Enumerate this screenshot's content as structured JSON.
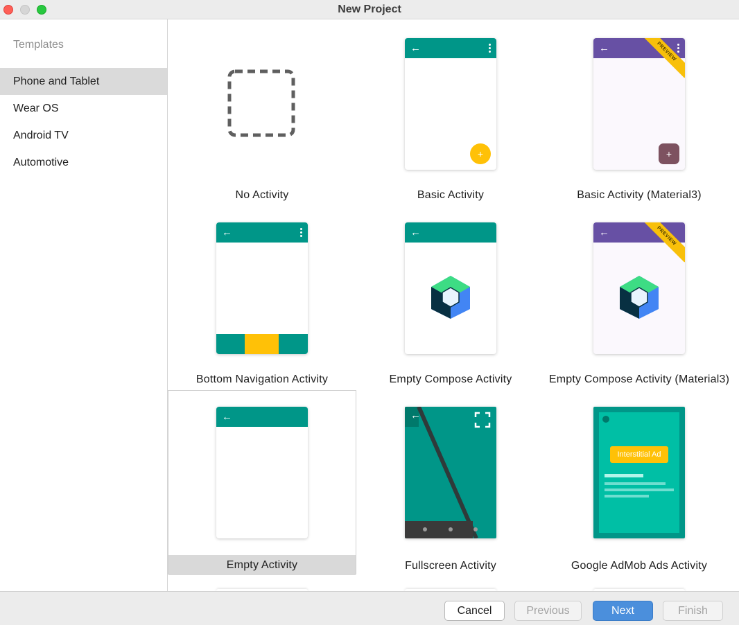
{
  "window": {
    "title": "New Project"
  },
  "sidebar": {
    "header": "Templates",
    "items": [
      {
        "label": "Phone and Tablet",
        "selected": true
      },
      {
        "label": "Wear OS",
        "selected": false
      },
      {
        "label": "Android TV",
        "selected": false
      },
      {
        "label": "Automotive",
        "selected": false
      }
    ]
  },
  "templates": [
    {
      "label": "No Activity",
      "icon": "dashed-square-icon"
    },
    {
      "label": "Basic Activity",
      "icon": "phone-appbar-fab-icon"
    },
    {
      "label": "Basic Activity (Material3)",
      "icon": "phone-material3-fab-icon",
      "badge": "PREVIEW"
    },
    {
      "label": "Bottom Navigation Activity",
      "icon": "phone-bottom-nav-icon"
    },
    {
      "label": "Empty Compose Activity",
      "icon": "jetpack-compose-icon"
    },
    {
      "label": "Empty Compose Activity (Material3)",
      "icon": "jetpack-compose-icon",
      "badge": "PREVIEW"
    },
    {
      "label": "Empty Activity",
      "icon": "phone-appbar-icon",
      "selected": true
    },
    {
      "label": "Fullscreen Activity",
      "icon": "fullscreen-icon"
    },
    {
      "label": "Google AdMob Ads Activity",
      "icon": "admob-icon",
      "ad_label": "Interstitial Ad"
    }
  ],
  "footer": {
    "cancel": "Cancel",
    "previous": "Previous",
    "next": "Next",
    "finish": "Finish"
  },
  "colors": {
    "teal": "#009688",
    "purple": "#6750a4",
    "amber": "#ffc107",
    "material3_fab": "#7d5260",
    "admob_bg": "#00bfa5",
    "accent_button": "#4b8fdc"
  }
}
